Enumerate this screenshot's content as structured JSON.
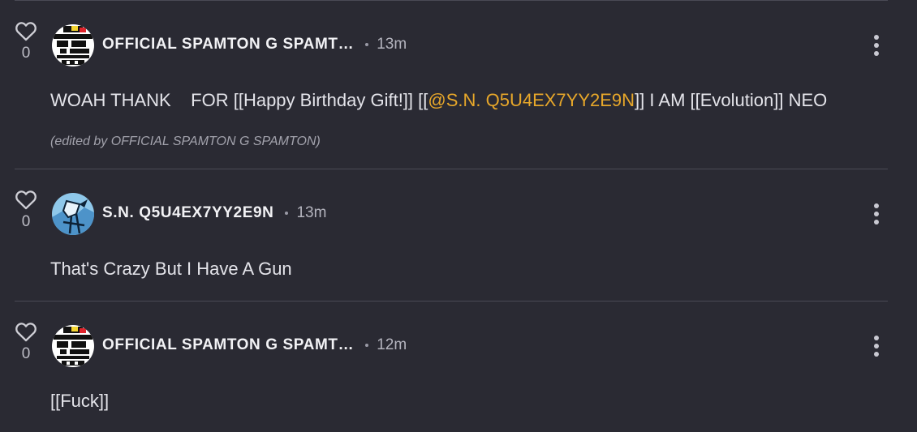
{
  "comments": [
    {
      "like_count": "0",
      "username": "OFFICIAL SPAMTON G SPAMT…",
      "time": "13m",
      "body_before": "WOAH THANK    FOR [[Happy Birthday Gift!]] [[",
      "mention": "@S.N. Q5U4EX7YY2E9N",
      "body_after": "]] I AM [[Evolution]] NEO",
      "edited_note": "(edited by OFFICIAL SPAMTON G SPAMTON)"
    },
    {
      "like_count": "0",
      "username": "S.N. Q5U4EX7YY2E9N",
      "time": "13m",
      "body": "That's Crazy But I Have A Gun"
    },
    {
      "like_count": "0",
      "username": "OFFICIAL SPAMTON G SPAMT…",
      "time": "12m",
      "body": "[[Fuck]]"
    }
  ],
  "icons": {
    "like": "heart-outline-icon",
    "menu": "more-vertical-icon"
  },
  "colors": {
    "background": "#2a2a33",
    "mention": "#e7a72a",
    "divider": "#4a4a55"
  }
}
